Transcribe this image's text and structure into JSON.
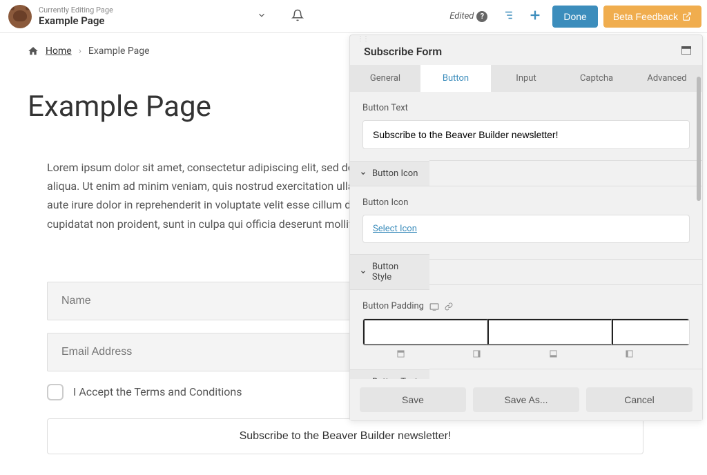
{
  "toolbar": {
    "editing_label": "Currently Editing Page",
    "page_title": "Example Page",
    "edited_label": "Edited",
    "done_label": "Done",
    "feedback_label": "Beta Feedback"
  },
  "breadcrumb": {
    "home": "Home",
    "current": "Example Page"
  },
  "page": {
    "heading": "Example Page",
    "body_text": "Lorem ipsum dolor sit amet, consectetur adipiscing elit, sed do eiusmod tempor incididunt ut labore et dolore magna aliqua. Ut enim ad minim veniam, quis nostrud exercitation ullamco laboris nisi ut aliquip ex ea commodo consequat. Duis aute irure dolor in reprehenderit in voluptate velit esse cillum dolore eu fugiat nulla pariatur. Excepteur sint occaecat cupidatat non proident, sunt in culpa qui officia deserunt mollit anim id est laborum.",
    "form": {
      "name_placeholder": "Name",
      "email_placeholder": "Email Address",
      "terms_label": "I Accept the Terms and Conditions",
      "submit_label": "Subscribe to the Beaver Builder newsletter!"
    }
  },
  "panel": {
    "title": "Subscribe Form",
    "tabs": {
      "general": "General",
      "button": "Button",
      "input": "Input",
      "captcha": "Captcha",
      "advanced": "Advanced"
    },
    "fields": {
      "button_text_label": "Button Text",
      "button_text_value": "Subscribe to the Beaver Builder newsletter!",
      "button_icon_section": "Button Icon",
      "button_icon_label": "Button Icon",
      "select_icon_link": "Select Icon",
      "button_style_section": "Button Style",
      "button_padding_label": "Button Padding",
      "padding_unit": "px",
      "button_text_section": "Button Text"
    },
    "footer": {
      "save": "Save",
      "save_as": "Save As...",
      "cancel": "Cancel"
    }
  }
}
